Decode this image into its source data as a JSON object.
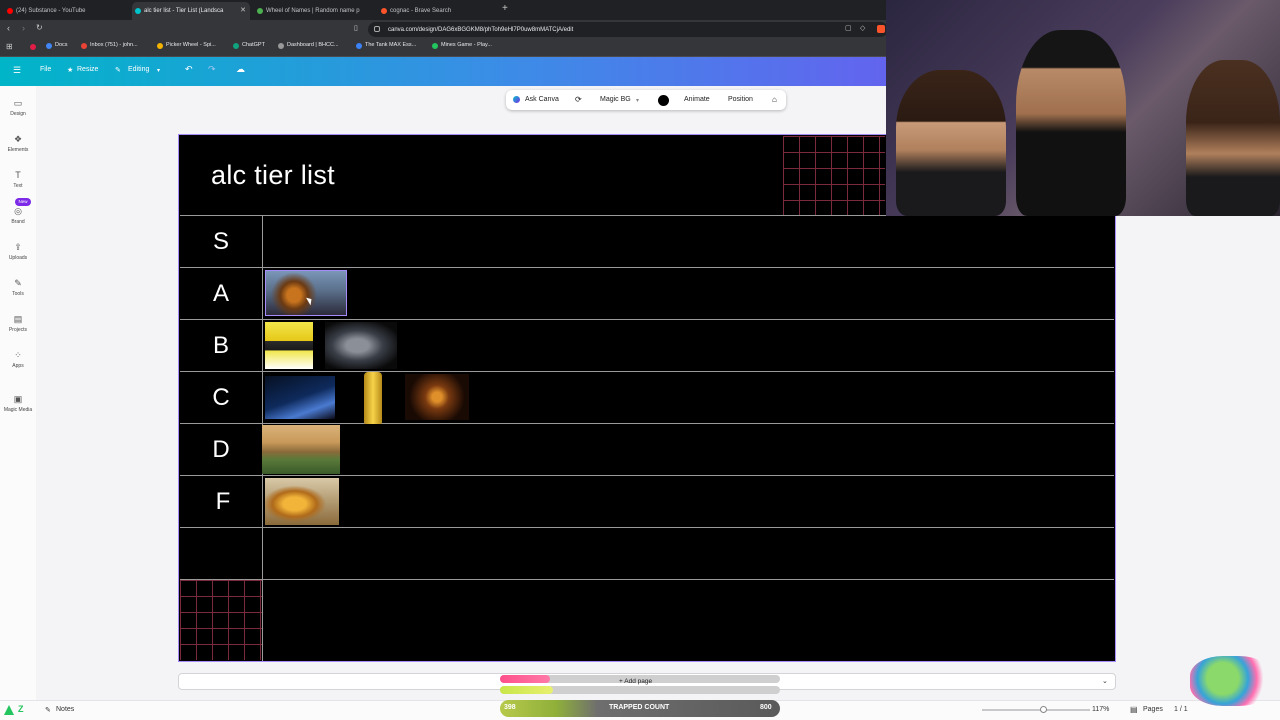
{
  "browser": {
    "tabs": [
      {
        "label": "(24) Substance - YouTube",
        "color": "#ff0000"
      },
      {
        "label": "alc tier list - Tier List (Landsca",
        "color": "#00c4cc",
        "active": true
      },
      {
        "label": "Wheel of Names | Random name p",
        "color": "#4caf50"
      },
      {
        "label": "cognac - Brave Search",
        "color": "#fb542b"
      }
    ],
    "new_tab": "+",
    "url": "canva.com/design/DAG6xBGGKM8/phToh9eHl7P0uw8mMATCjA/edit",
    "bookmarks": [
      {
        "label": "Docs",
        "color": "#4285f4"
      },
      {
        "label": "Inbox (751) - john...",
        "color": "#ea4335"
      },
      {
        "label": "Picker Wheel - Spi...",
        "color": "#f4b400"
      },
      {
        "label": "ChatGPT",
        "color": "#10a37f"
      },
      {
        "label": "Dashboard | BHCC...",
        "color": "#999999"
      },
      {
        "label": "The Tank MAX Ess...",
        "color": "#3b82f6"
      },
      {
        "label": "Mines Game - Play...",
        "color": "#22c55e"
      }
    ]
  },
  "canva": {
    "menu": {
      "file": "File",
      "resize": "Resize",
      "editing": "Editing"
    },
    "rail": [
      {
        "label": "Design",
        "icon": "design-icon"
      },
      {
        "label": "Elements",
        "icon": "elements-icon"
      },
      {
        "label": "Text",
        "icon": "text-icon"
      },
      {
        "label": "Brand",
        "icon": "brand-icon"
      },
      {
        "label": "Uploads",
        "icon": "uploads-icon"
      },
      {
        "label": "Tools",
        "icon": "tools-icon"
      },
      {
        "label": "Projects",
        "icon": "projects-icon"
      },
      {
        "label": "Apps",
        "icon": "apps-icon"
      },
      {
        "label": "Magic Media",
        "icon": "magic-media-icon"
      }
    ],
    "new_badge": "New",
    "context_toolbar": {
      "ask": "Ask Canva",
      "magic_bg": "Magic BG",
      "animate": "Animate",
      "position": "Position"
    }
  },
  "tierlist": {
    "title": "alc tier list",
    "tiers": [
      "S",
      "A",
      "B",
      "C",
      "D",
      "F",
      ""
    ]
  },
  "bottom": {
    "add_page": "+ Add page",
    "notes": "Notes",
    "zoom": "117%",
    "pages": "Pages",
    "page_count": "1 / 1"
  },
  "overlay": {
    "trapped_label": "TRAPPED COUNT",
    "trapped_left": "398",
    "trapped_right": "800"
  },
  "colors": {
    "accent": "#7d2ae8",
    "canvas_bg": "#000000",
    "grid": "#7a2a3a"
  }
}
